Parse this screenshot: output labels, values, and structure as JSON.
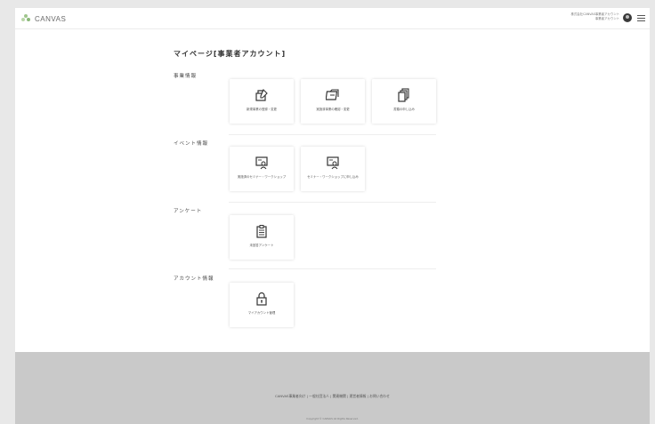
{
  "header": {
    "logo_text": "CANVAS",
    "user_line1": "株式会社CANVAS事業者アカウント",
    "user_line2": "事業者アカウント"
  },
  "page_title": "マイページ[事業者アカウント]",
  "sections": [
    {
      "title": "事業情報",
      "cards": [
        {
          "label": "新規事業の登録・変更",
          "icon": "register-icon"
        },
        {
          "label": "実施済事業の確認・変更",
          "icon": "business-folder-icon"
        },
        {
          "label": "書類の申し込み",
          "icon": "documents-icon"
        }
      ]
    },
    {
      "title": "イベント情報",
      "cards": [
        {
          "label": "実施済のセミナー・ワークショップ",
          "icon": "seminar-icon"
        },
        {
          "label": "セミナー・ワークショップに申し込み",
          "icon": "seminar-apply-icon"
        }
      ]
    },
    {
      "title": "アンケート",
      "cards": [
        {
          "label": "未回答アンケート",
          "icon": "clipboard-icon"
        }
      ]
    },
    {
      "title": "アカウント情報",
      "cards": [
        {
          "label": "マイアカウント管理",
          "icon": "lock-icon"
        }
      ]
    }
  ],
  "footer": {
    "links": "CANVAS事業者向け | 一般社団法人 | 関連機関 | 運営者情報 | お問い合わせ",
    "copyright": "Copyright © CANVAS All Rights Reserved."
  },
  "colors": {
    "logo_accent": "#9fc58c",
    "footer_bg": "#c9c9c9",
    "avatar": "#3a3a3a"
  }
}
